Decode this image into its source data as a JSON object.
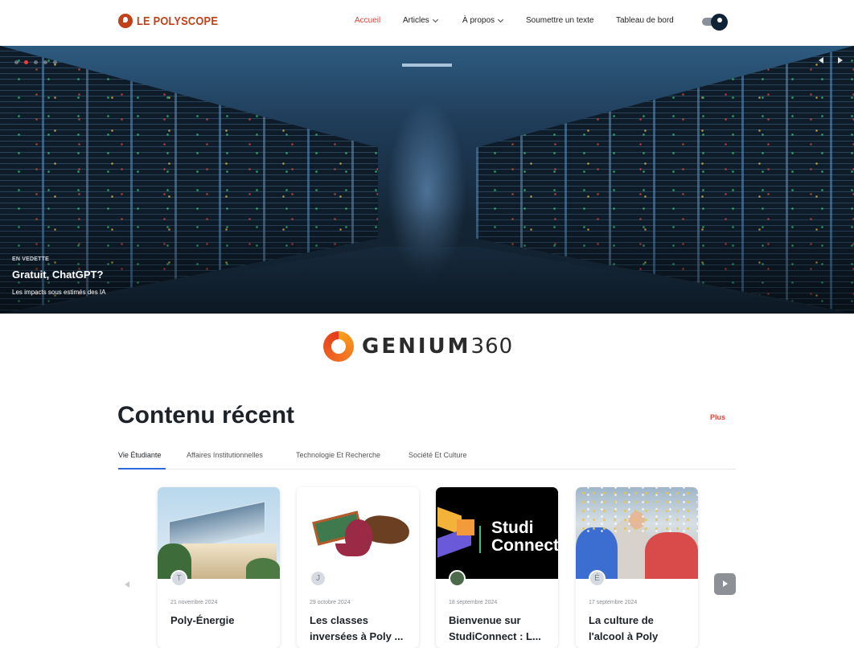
{
  "site": {
    "logo_text": "LE POLYSCOPE",
    "brand_color": "#c1411b",
    "accent_color": "#e2433a"
  },
  "nav": {
    "items": [
      {
        "label": "Accueil",
        "active": true
      },
      {
        "label": "Articles",
        "has_dropdown": true
      },
      {
        "label": "À propos",
        "has_dropdown": true
      },
      {
        "label": "Soumettre un texte"
      },
      {
        "label": "Tableau de bord"
      }
    ],
    "theme_toggle_icon": "moon-icon"
  },
  "hero": {
    "eyebrow": "EN VEDETTE",
    "title": "Gratuit, ChatGPT?",
    "subtitle": "Les impacts sous estimés des IA",
    "slide_count": 5,
    "active_slide": 2
  },
  "sponsor": {
    "name": "GENIUM",
    "number": "360"
  },
  "recent": {
    "title": "Contenu récent",
    "more_label": "Plus",
    "tabs": [
      {
        "label": "Vie Étudiante",
        "active": true
      },
      {
        "label": "Affaires Institutionnelles"
      },
      {
        "label": "Technologie Et Recherche"
      },
      {
        "label": "Société Et Culture"
      }
    ],
    "cards": [
      {
        "avatar": "T",
        "date": "21 novembre 2024",
        "title": "Poly-Énergie",
        "image": "building"
      },
      {
        "avatar": "J",
        "date": "29 octobre 2024",
        "title": "Les classes inversées à Poly ...",
        "image": "cartoon",
        "image_text": "CLASSE"
      },
      {
        "avatar": "",
        "date": "18 septembre 2024",
        "title": "Bienvenue sur StudiConnect : L...",
        "image": "studiconnect",
        "image_text": "Studi Connect"
      },
      {
        "avatar": "É",
        "date": "17 septembre 2024",
        "title": "La culture de l'alcool à Poly",
        "image": "crowd"
      }
    ]
  }
}
